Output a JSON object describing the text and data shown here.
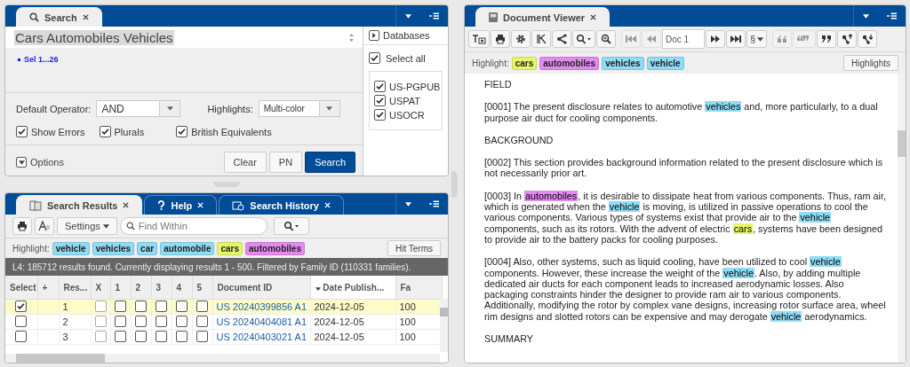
{
  "search_panel": {
    "tab": {
      "label": "Search",
      "selected": true
    },
    "query": "Cars Automobiles Vehicles",
    "sets": [
      "Sel 1...26"
    ],
    "default_operator": {
      "label": "Default Operator:",
      "value": "AND"
    },
    "highlights": {
      "label": "Highlights:",
      "value": "Multi-color"
    },
    "checkboxes": [
      {
        "label": "Show Errors",
        "checked": true
      },
      {
        "label": "Plurals",
        "checked": true
      },
      {
        "label": "British Equivalents",
        "checked": true
      }
    ],
    "options_label": "Options",
    "buttons": [
      {
        "label": "Clear",
        "kind": "default"
      },
      {
        "label": "PN",
        "kind": "default"
      },
      {
        "label": "Search",
        "kind": "primary"
      }
    ],
    "databases": {
      "title": "Databases",
      "select_all": {
        "label": "Select all",
        "checked": true
      },
      "items": [
        {
          "label": "US-PGPUB",
          "checked": true
        },
        {
          "label": "USPAT",
          "checked": true
        },
        {
          "label": "USOCR",
          "checked": true
        }
      ]
    }
  },
  "results_panel": {
    "tabs": [
      {
        "label": "Search Results",
        "kind": "results",
        "selected": true
      },
      {
        "label": "Help",
        "kind": "help",
        "selected": false
      },
      {
        "label": "Search History",
        "kind": "history",
        "selected": false
      }
    ],
    "settings_label": "Settings",
    "find": {
      "placeholder": "Find Within"
    },
    "highlight_label": "Highlight:",
    "terms": [
      {
        "text": "vehicle",
        "color": "#8fdcf5"
      },
      {
        "text": "vehicles",
        "color": "#8fdcf5"
      },
      {
        "text": "car",
        "color": "#8fdcf5"
      },
      {
        "text": "automobile",
        "color": "#8fdcf5"
      },
      {
        "text": "cars",
        "color": "#e6f56a"
      },
      {
        "text": "automobiles",
        "color": "#e38af0"
      }
    ],
    "hit_terms_button": "Hit Terms",
    "status": "L4:  185712 results found. Currently displaying results 1 - 500. Filtered by Family ID (110331 families).",
    "table": {
      "columns": [
        {
          "label": "Select",
          "sorted": false
        },
        {
          "label": "+",
          "sorted": false
        },
        {
          "label": "Res...",
          "sorted": false
        },
        {
          "label": "X",
          "sorted": false
        },
        {
          "label": "1",
          "sorted": false
        },
        {
          "label": "2",
          "sorted": false
        },
        {
          "label": "3",
          "sorted": false
        },
        {
          "label": "4",
          "sorted": false
        },
        {
          "label": "5",
          "sorted": false
        },
        {
          "label": "Document ID",
          "sorted": false
        },
        {
          "label": "Date Publish...",
          "sorted": true
        },
        {
          "label": "Fa",
          "sorted": false
        }
      ],
      "rows": [
        {
          "selected": true,
          "checked": true,
          "result": "1",
          "marks": [
            false,
            false,
            false,
            false,
            false,
            false
          ],
          "document_id": "US 20240399856 A1",
          "date": "2024-12-05",
          "family": "100"
        },
        {
          "selected": false,
          "checked": false,
          "result": "2",
          "marks": [
            false,
            false,
            false,
            false,
            false,
            false
          ],
          "document_id": "US 20240404081 A1",
          "date": "2024-12-05",
          "family": "100"
        },
        {
          "selected": false,
          "checked": false,
          "result": "3",
          "marks": [
            false,
            false,
            false,
            false,
            false,
            false
          ],
          "document_id": "US 20240403021 A1",
          "date": "2024-12-05",
          "family": "100"
        }
      ]
    }
  },
  "viewer_panel": {
    "tab": {
      "label": "Document Viewer",
      "selected": true
    },
    "toolbar": [
      {
        "kind": "text-image",
        "disabled": false
      },
      {
        "kind": "print",
        "disabled": false
      },
      {
        "kind": "gear",
        "disabled": false
      },
      {
        "kind": "kwic",
        "disabled": false
      },
      {
        "kind": "share",
        "disabled": false
      },
      {
        "kind": "search-menu",
        "disabled": false
      },
      {
        "kind": "zoom",
        "disabled": false
      },
      {
        "kind": "first",
        "disabled": true
      },
      {
        "kind": "prev",
        "disabled": true
      },
      {
        "kind": "doc",
        "label": "Doc 1"
      },
      {
        "kind": "next",
        "disabled": false
      },
      {
        "kind": "last",
        "disabled": false
      },
      {
        "kind": "section",
        "label": "§",
        "disabled": false
      },
      {
        "kind": "quote-open",
        "disabled": true
      },
      {
        "kind": "quote-both",
        "disabled": true
      },
      {
        "kind": "quote-close",
        "disabled": false
      },
      {
        "kind": "node-up",
        "disabled": false
      },
      {
        "kind": "node-down",
        "disabled": false
      }
    ],
    "highlight_label": "Highlight:",
    "terms": [
      {
        "text": "cars",
        "color": "#e6f56a"
      },
      {
        "text": "automobiles",
        "color": "#e38af0"
      },
      {
        "text": "vehicles",
        "color": "#8fdcf5"
      },
      {
        "text": "vehicle",
        "color": "#8fdcf5"
      }
    ],
    "highlights_button": "Highlights",
    "paragraphs": [
      [
        {
          "text": "FIELD"
        }
      ],
      [
        {
          "text": "[0001] The present disclosure relates to automotive "
        },
        {
          "text": "vehicles",
          "color": "#8fdcf5"
        },
        {
          "text": " and, more particularly, to a dual purpose air duct for cooling components."
        }
      ],
      [
        {
          "text": "BACKGROUND"
        }
      ],
      [
        {
          "text": "[0002] This section provides background information related to the present disclosure which is not necessarily prior art."
        }
      ],
      [
        {
          "text": "[0003] In "
        },
        {
          "text": "automobiles",
          "color": "#e38af0"
        },
        {
          "text": ", it is desirable to dissipate heat from various components. Thus, ram air, which is generated when the "
        },
        {
          "text": "vehicle",
          "color": "#8fdcf5"
        },
        {
          "text": " is moving, is utilized in passive operations to cool the various components. Various types of systems exist that provide air to the "
        },
        {
          "text": "vehicle",
          "color": "#8fdcf5"
        },
        {
          "text": " components, such as its rotors. With the advent of electric "
        },
        {
          "text": "cars",
          "color": "#e6f56a"
        },
        {
          "text": ", systems have been designed to provide air to the battery packs for cooling purposes."
        }
      ],
      [
        {
          "text": "[0004] Also, other systems, such as liquid cooling, have been utilized to cool "
        },
        {
          "text": "vehicle",
          "color": "#8fdcf5"
        },
        {
          "text": " components. However, these increase the weight of the "
        },
        {
          "text": "vehicle",
          "color": "#8fdcf5"
        },
        {
          "text": ". Also, by adding multiple dedicated air ducts for each component leads to increased aerodynamic losses. Also packaging constraints hinder the designer to provide ram air to various components. Additionally, modifying the rotor by complex vane designs, increasing rotor surface area, wheel rim designs and slotted rotors can be expensive and may derogate "
        },
        {
          "text": "vehicle",
          "color": "#8fdcf5"
        },
        {
          "text": " aerodynamics."
        }
      ],
      [
        {
          "text": "SUMMARY"
        }
      ]
    ]
  }
}
